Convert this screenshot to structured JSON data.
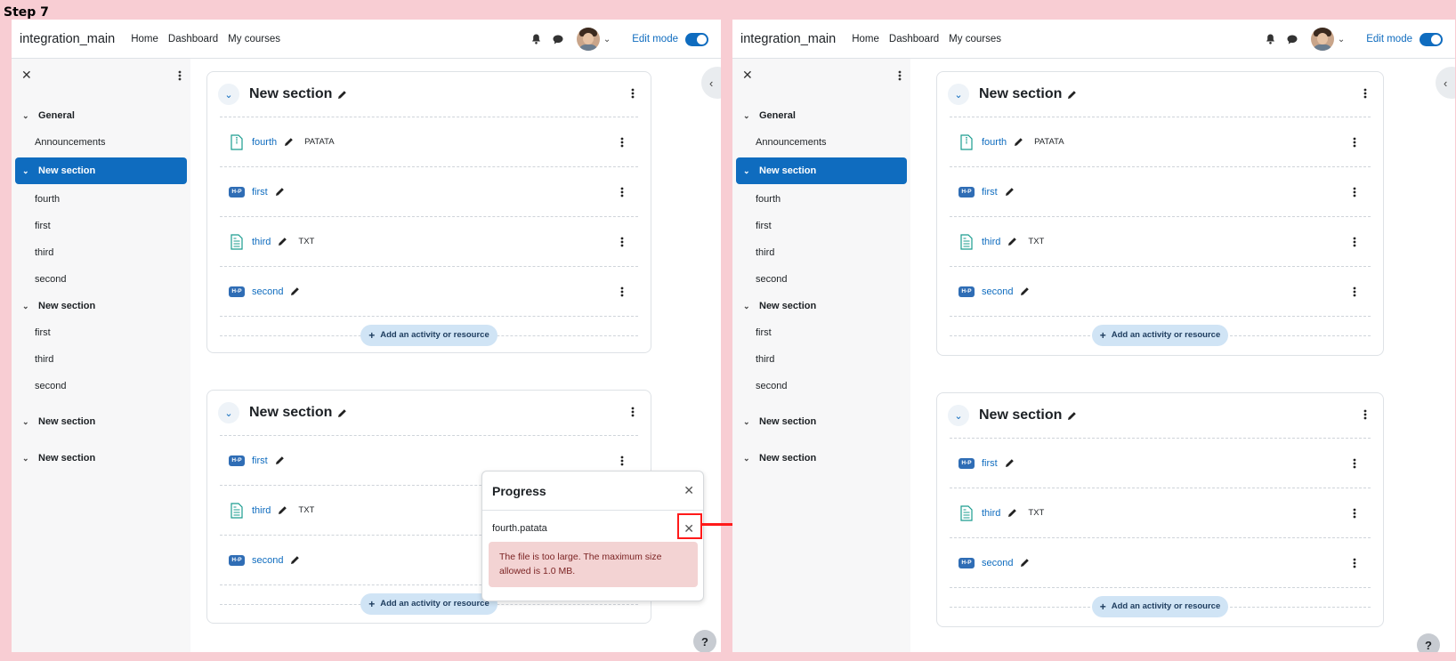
{
  "step": "Step 7",
  "site": {
    "brand": "integration_main",
    "nav": [
      "Home",
      "Dashboard",
      "My courses"
    ],
    "edit_mode": "Edit mode"
  },
  "course_index": {
    "sections": [
      {
        "title": "General",
        "items": [
          "Announcements"
        ],
        "active": false
      },
      {
        "title": "New section",
        "items": [
          "fourth",
          "first",
          "third",
          "second"
        ],
        "active": true
      },
      {
        "title": "New section",
        "items": [
          "first",
          "third",
          "second"
        ],
        "active": false
      },
      {
        "title": "New section",
        "items": [],
        "active": false
      },
      {
        "title": "New section",
        "items": [],
        "active": false
      }
    ]
  },
  "sections": [
    {
      "title": "New section",
      "activities": [
        {
          "name": "fourth",
          "type": "file",
          "badge": "PATATA"
        },
        {
          "name": "first",
          "type": "h5p",
          "badge": ""
        },
        {
          "name": "third",
          "type": "text",
          "badge": "TXT"
        },
        {
          "name": "second",
          "type": "h5p",
          "badge": ""
        }
      ],
      "add_label": "Add an activity or resource"
    },
    {
      "title": "New section",
      "activities": [
        {
          "name": "first",
          "type": "h5p",
          "badge": ""
        },
        {
          "name": "third",
          "type": "text",
          "badge": "TXT"
        },
        {
          "name": "second",
          "type": "h5p",
          "badge": ""
        }
      ],
      "add_label": "Add an activity or resource"
    }
  ],
  "progress_dialog": {
    "title": "Progress",
    "filename": "fourth.patata",
    "error": "The file is too large. The maximum size allowed is 1.0 MB."
  },
  "icons": {
    "close": "close-icon",
    "kebab": "kebab-icon",
    "bell": "bell-icon",
    "chat": "chat-icon",
    "pencil": "pencil-icon",
    "h5p_badge": "H-P",
    "help": "?"
  },
  "colors": {
    "primary": "#0f6cbf",
    "background": "#f8cdd3",
    "annotation": "#ff1a1a",
    "error_bg": "#f3d3d3",
    "error_text": "#7c2424"
  }
}
